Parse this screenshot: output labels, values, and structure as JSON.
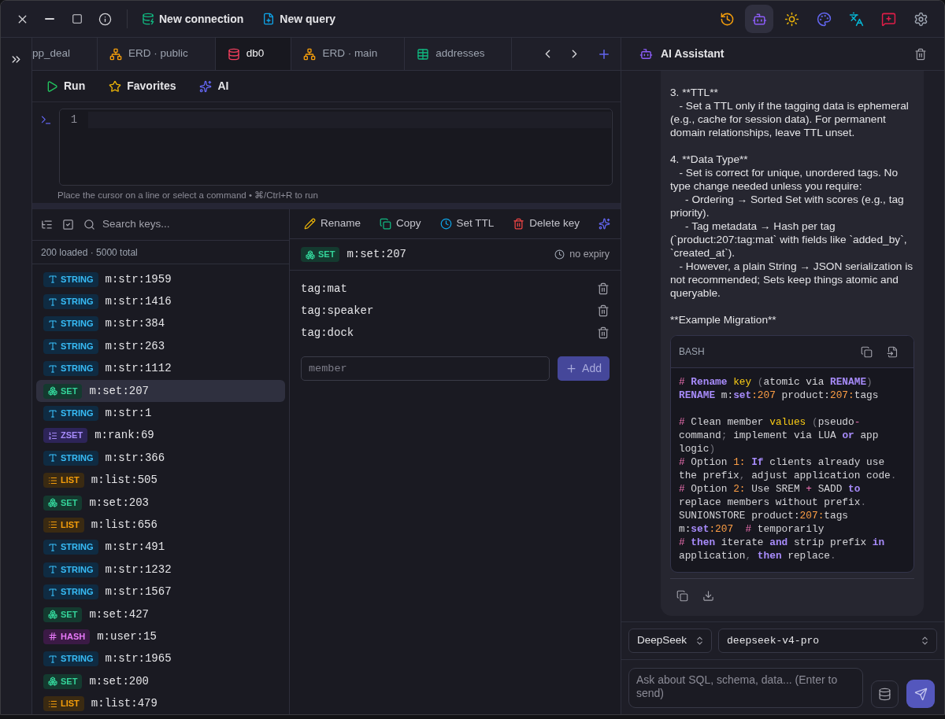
{
  "top_bar": {
    "actions": [
      {
        "label": "New connection",
        "kind": "connection"
      },
      {
        "label": "New query",
        "kind": "query"
      }
    ],
    "icons": [
      {
        "kind": "history",
        "selected": false
      },
      {
        "kind": "assistant",
        "selected": true
      },
      {
        "kind": "theme",
        "selected": false
      },
      {
        "kind": "palette",
        "selected": false
      },
      {
        "kind": "language",
        "selected": false
      },
      {
        "kind": "feedback",
        "selected": false
      },
      {
        "kind": "settings",
        "selected": false
      }
    ]
  },
  "tabs": [
    {
      "label": "pp_deal",
      "kind": "plain",
      "selected": false
    },
    {
      "label": "ERD · public",
      "kind": "erd",
      "selected": false
    },
    {
      "label": "db0",
      "kind": "database",
      "selected": true
    },
    {
      "label": "ERD · main",
      "kind": "erd",
      "selected": false
    },
    {
      "label": "addresses",
      "kind": "table",
      "selected": false
    }
  ],
  "query_toolbar": [
    {
      "label": "Run",
      "kind": "run"
    },
    {
      "label": "Favorites",
      "kind": "favorites"
    },
    {
      "label": "AI",
      "kind": "ai"
    }
  ],
  "editor": {
    "line_numbers": [
      "1"
    ],
    "hint": "Place the cursor on a line or select a command • ⌘/Ctrl+R to run"
  },
  "key_browser": {
    "search": {
      "placeholder": "Search keys..."
    },
    "summary": "200 loaded · 5000 total",
    "keys": [
      {
        "type": "STRING",
        "kind": "string",
        "name": "m:str:1959",
        "selected": false
      },
      {
        "type": "STRING",
        "kind": "string",
        "name": "m:str:1416",
        "selected": false
      },
      {
        "type": "STRING",
        "kind": "string",
        "name": "m:str:384",
        "selected": false
      },
      {
        "type": "STRING",
        "kind": "string",
        "name": "m:str:263",
        "selected": false
      },
      {
        "type": "STRING",
        "kind": "string",
        "name": "m:str:1112",
        "selected": false
      },
      {
        "type": "SET",
        "kind": "set",
        "name": "m:set:207",
        "selected": true
      },
      {
        "type": "STRING",
        "kind": "string",
        "name": "m:str:1",
        "selected": false
      },
      {
        "type": "ZSET",
        "kind": "zset",
        "name": "m:rank:69",
        "selected": false
      },
      {
        "type": "STRING",
        "kind": "string",
        "name": "m:str:366",
        "selected": false
      },
      {
        "type": "LIST",
        "kind": "list",
        "name": "m:list:505",
        "selected": false
      },
      {
        "type": "SET",
        "kind": "set",
        "name": "m:set:203",
        "selected": false
      },
      {
        "type": "LIST",
        "kind": "list",
        "name": "m:list:656",
        "selected": false
      },
      {
        "type": "STRING",
        "kind": "string",
        "name": "m:str:491",
        "selected": false
      },
      {
        "type": "STRING",
        "kind": "string",
        "name": "m:str:1232",
        "selected": false
      },
      {
        "type": "STRING",
        "kind": "string",
        "name": "m:str:1567",
        "selected": false
      },
      {
        "type": "SET",
        "kind": "set",
        "name": "m:set:427",
        "selected": false
      },
      {
        "type": "HASH",
        "kind": "hash",
        "name": "m:user:15",
        "selected": false
      },
      {
        "type": "STRING",
        "kind": "string",
        "name": "m:str:1965",
        "selected": false
      },
      {
        "type": "SET",
        "kind": "set",
        "name": "m:set:200",
        "selected": false
      },
      {
        "type": "LIST",
        "kind": "list",
        "name": "m:list:479",
        "selected": false
      }
    ]
  },
  "key_detail": {
    "actions": [
      {
        "label": "Rename",
        "kind": "rename"
      },
      {
        "label": "Copy",
        "kind": "copy"
      },
      {
        "label": "Set TTL",
        "kind": "ttl"
      },
      {
        "label": "Delete key",
        "kind": "delete"
      },
      {
        "kind": "ai"
      }
    ],
    "key": {
      "type": "SET",
      "kind": "set",
      "name": "m:set:207",
      "expiry": "no expiry"
    },
    "members": [
      "tag:mat",
      "tag:speaker",
      "tag:dock"
    ],
    "new_member": {
      "placeholder": "member"
    },
    "add_button": {
      "label": "Add",
      "disabled": true
    }
  },
  "assistant": {
    "title": "AI Assistant",
    "message": {
      "paragraphs": [
        [
          "3. **TTL**",
          "   - Set a TTL only if the tagging data is ephemeral (e.g., cache for session data). For permanent domain relationships, leave TTL unset."
        ],
        [
          "4. **Data Type**",
          "   - Set is correct for unique, unordered tags. No type change needed unless you require:",
          "     - Ordering → Sorted Set with scores (e.g., tag priority).",
          "     - Tag metadata → Hash per tag (`product:207:tag:mat` with fields like `added_by`, `created_at`).",
          "   - However, a plain String → JSON serialization is not recommended; Sets keep things atomic and queryable."
        ],
        [
          "**Example Migration**"
        ]
      ],
      "code": {
        "language": "BASH",
        "blocks": [
          [
            [
              {
                "text": "#",
                "kind": "comment"
              },
              {
                "text": " Rename",
                "kind": "keyword"
              },
              {
                "text": " key",
                "kind": "builtin"
              },
              {
                "text": " (",
                "kind": "punct"
              },
              {
                "text": "atomic via ",
                "kind": "text"
              },
              {
                "text": "RENAME",
                "kind": "keyword"
              },
              {
                "text": ")",
                "kind": "punct"
              }
            ],
            [
              {
                "text": "RENAME",
                "kind": "keyword"
              },
              {
                "text": " m:",
                "kind": "text"
              },
              {
                "text": "set",
                "kind": "keyword"
              },
              {
                "text": ":207",
                "kind": "number"
              },
              {
                "text": " product:",
                "kind": "text"
              },
              {
                "text": "207:",
                "kind": "number"
              },
              {
                "text": "tags",
                "kind": "text"
              }
            ]
          ],
          [
            [
              {
                "text": "#",
                "kind": "comment"
              },
              {
                "text": " Clean member ",
                "kind": "text"
              },
              {
                "text": "values",
                "kind": "builtin"
              },
              {
                "text": " (",
                "kind": "punct"
              },
              {
                "text": "pseudo",
                "kind": "text"
              },
              {
                "text": "-",
                "kind": "operator"
              },
              {
                "text": "command",
                "kind": "text"
              },
              {
                "text": ";",
                "kind": "punct"
              },
              {
                "text": " implement via LUA ",
                "kind": "text"
              },
              {
                "text": "or",
                "kind": "keyword"
              },
              {
                "text": " app logic",
                "kind": "text"
              },
              {
                "text": ")",
                "kind": "punct"
              }
            ],
            [
              {
                "text": "#",
                "kind": "comment"
              },
              {
                "text": " Option ",
                "kind": "text"
              },
              {
                "text": "1:",
                "kind": "number"
              },
              {
                "text": " If",
                "kind": "keyword"
              },
              {
                "text": " clients already use the prefix",
                "kind": "text"
              },
              {
                "text": ",",
                "kind": "punct"
              },
              {
                "text": " adjust application code",
                "kind": "text"
              },
              {
                "text": ".",
                "kind": "punct"
              }
            ],
            [
              {
                "text": "#",
                "kind": "comment"
              },
              {
                "text": " Option ",
                "kind": "text"
              },
              {
                "text": "2:",
                "kind": "number"
              },
              {
                "text": " Use SREM ",
                "kind": "text"
              },
              {
                "text": "+",
                "kind": "operator"
              },
              {
                "text": " SADD ",
                "kind": "text"
              },
              {
                "text": "to",
                "kind": "keyword"
              },
              {
                "text": " replace members without prefix",
                "kind": "text"
              },
              {
                "text": ".",
                "kind": "punct"
              }
            ],
            [
              {
                "text": "SUNIONSTORE product:",
                "kind": "text"
              },
              {
                "text": "207:",
                "kind": "number"
              },
              {
                "text": "tags m:",
                "kind": "text"
              },
              {
                "text": "set",
                "kind": "keyword"
              },
              {
                "text": ":207",
                "kind": "number"
              },
              {
                "text": "  #",
                "kind": "comment"
              },
              {
                "text": " temporarily",
                "kind": "text"
              }
            ],
            [
              {
                "text": "#",
                "kind": "comment"
              },
              {
                "text": " then",
                "kind": "keyword"
              },
              {
                "text": " iterate ",
                "kind": "text"
              },
              {
                "text": "and",
                "kind": "keyword"
              },
              {
                "text": " strip prefix ",
                "kind": "text"
              },
              {
                "text": "in",
                "kind": "keyword"
              },
              {
                "text": " application",
                "kind": "text"
              },
              {
                "text": ",",
                "kind": "punct"
              },
              {
                "text": " then",
                "kind": "keyword"
              },
              {
                "text": " replace",
                "kind": "text"
              },
              {
                "text": ".",
                "kind": "punct"
              }
            ]
          ]
        ]
      }
    },
    "provider": {
      "value": "DeepSeek"
    },
    "model": {
      "value": "deepseek-v4-pro"
    },
    "input": {
      "placeholder": "Ask about SQL, schema, data... (Enter to send)"
    }
  }
}
